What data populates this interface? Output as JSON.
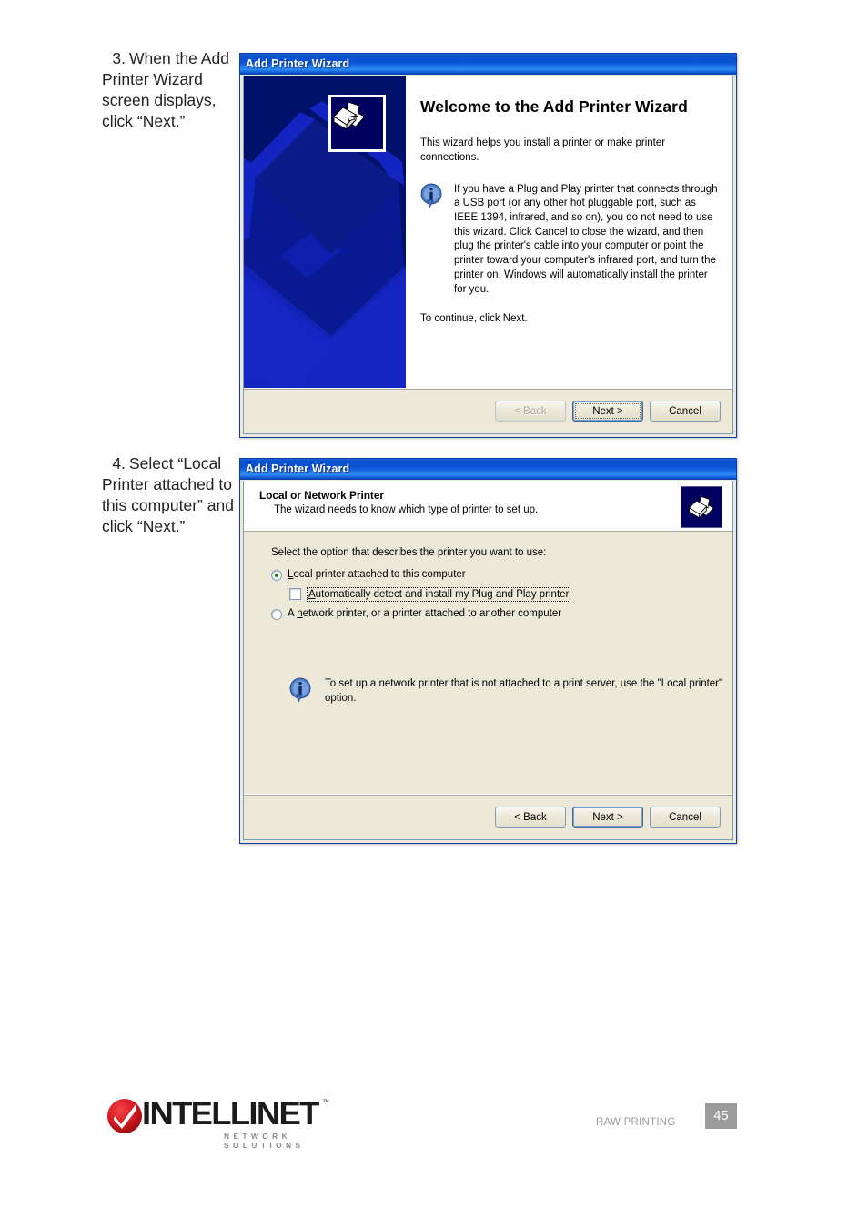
{
  "steps": [
    {
      "number": "3.",
      "text": "When the Add Printer Wizard screen displays, click “Next.”"
    },
    {
      "number": "4.",
      "text": "Select “Local Printer attached to this computer” and click “Next.”"
    }
  ],
  "dialog1": {
    "title": "Add Printer Wizard",
    "heading": "Welcome to the Add Printer Wizard",
    "intro": "This wizard helps you install a printer or make printer connections.",
    "info_icon": "information-icon",
    "info": "If you have a Plug and Play printer that connects through a USB port (or any other hot pluggable port, such as IEEE 1394, infrared, and so on), you do not need to use this wizard. Click Cancel to close the wizard, and then plug the printer's cable into your computer or point the printer toward your computer's infrared port, and turn the printer on. Windows will automatically install the printer for you.",
    "continue": "To continue, click Next.",
    "sidebar_icon": "printer-icon",
    "buttons": {
      "back": "< Back",
      "back_mnemonic": "B",
      "back_enabled": false,
      "next": "Next >",
      "next_mnemonic": "N",
      "next_default": true,
      "cancel": "Cancel"
    }
  },
  "dialog2": {
    "title": "Add Printer Wizard",
    "header_title": "Local or Network Printer",
    "header_sub": "The wizard needs to know which type of printer to set up.",
    "header_icon": "printer-icon",
    "prompt": "Select the option that describes the printer you want to use:",
    "options": [
      {
        "type": "radio",
        "label": "Local printer attached to this computer",
        "mnemonic": "L",
        "checked": true,
        "focused": false
      },
      {
        "type": "checkbox",
        "label": "Automatically detect and install my Plug and Play printer",
        "mnemonic": "A",
        "checked": false,
        "focused": true
      },
      {
        "type": "radio",
        "label": "A network printer, or a printer attached to another computer",
        "mnemonic": "n",
        "checked": false,
        "focused": false
      }
    ],
    "info_icon": "information-icon",
    "info": "To set up a network printer that is not attached to a print server, use the \"Local printer\" option.",
    "buttons": {
      "back": "< Back",
      "back_mnemonic": "B",
      "back_enabled": true,
      "next": "Next >",
      "next_mnemonic": "N",
      "next_default": true,
      "cancel": "Cancel"
    }
  },
  "footer": {
    "brand": "INTELLINET",
    "brand_tm": "™",
    "tagline": "NETWORK SOLUTIONS",
    "logo_icon": "checkmark-circle-icon",
    "section": "RAW PRINTING",
    "page": "45"
  },
  "colors": {
    "titlebar_blue": "#0a52d0",
    "dialog_face": "#ece9d8",
    "sidebar_navy": "#00106b",
    "accent_red": "#d71920",
    "footer_gray": "#9b9b9b"
  }
}
